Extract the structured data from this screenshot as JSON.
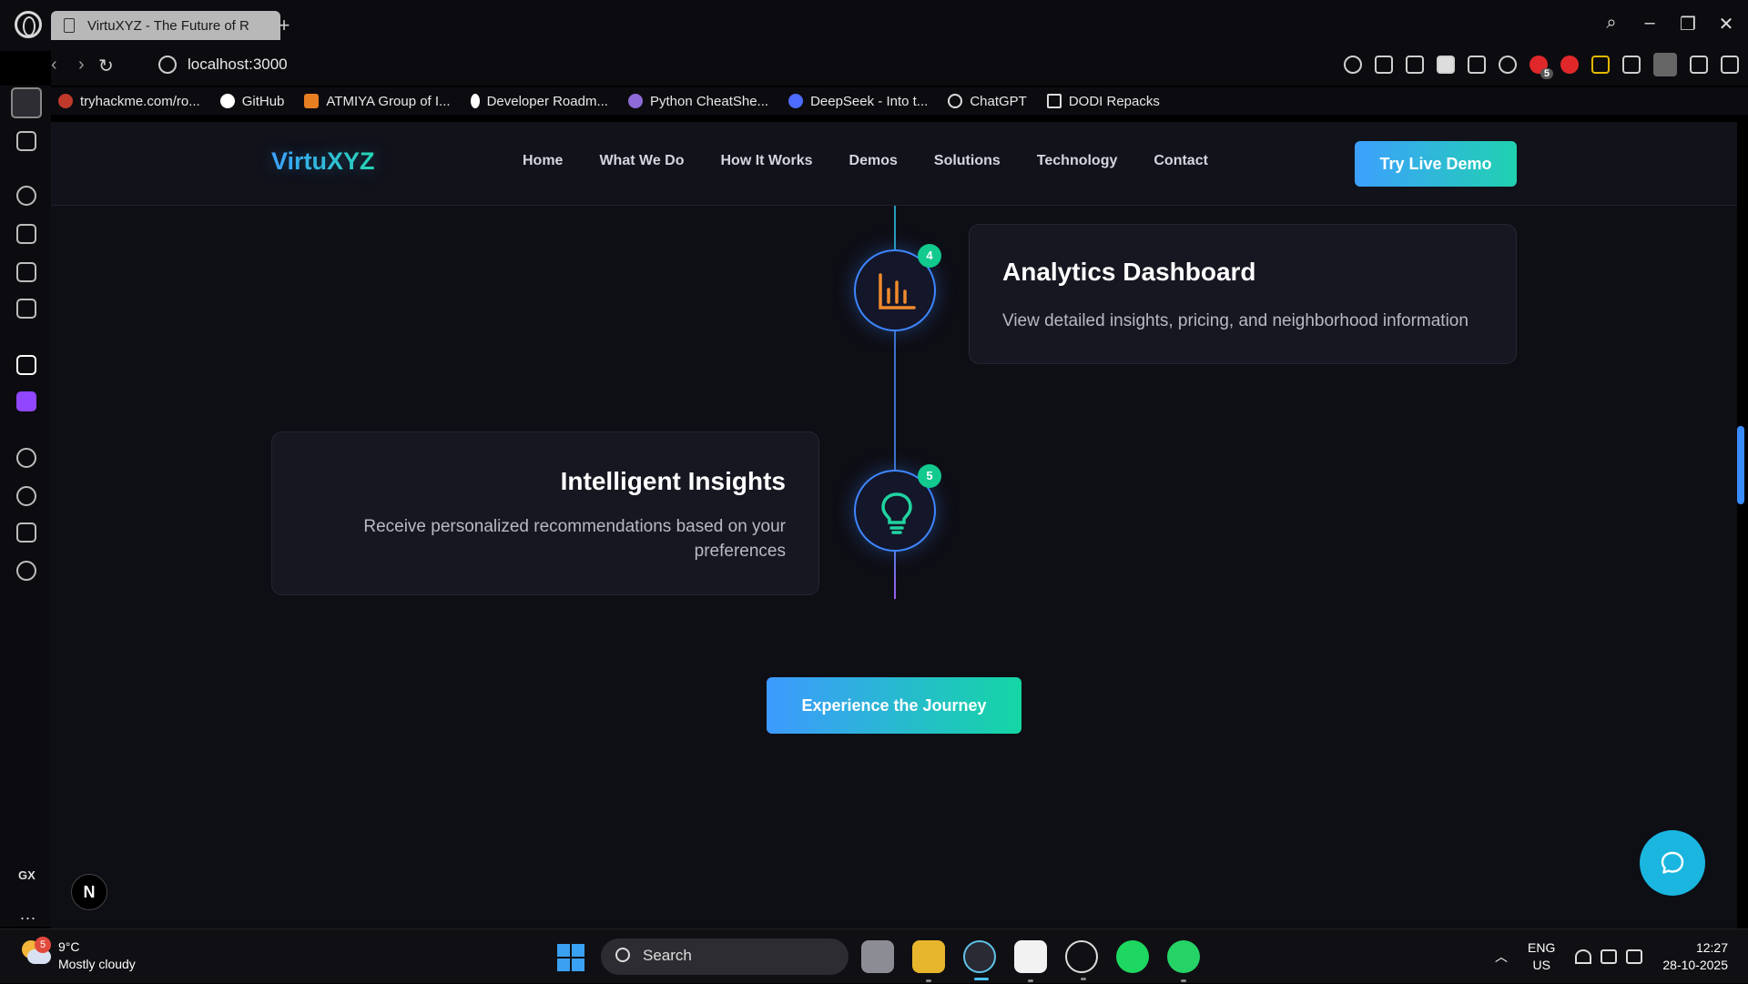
{
  "browser": {
    "tab_title": "VirtuXYZ - The Future of R",
    "new_tab_label": "+",
    "url": "localhost:3000",
    "bookmarks": [
      {
        "label": "tryhackme.com/ro...",
        "color": "#c0392b"
      },
      {
        "label": "GitHub",
        "color": "#ffffff"
      },
      {
        "label": "ATMIYA Group of I...",
        "color": "#e67e22"
      },
      {
        "label": "Developer Roadm...",
        "color": "#ffffff"
      },
      {
        "label": "Python CheatShe...",
        "color": "#8e6ad8"
      },
      {
        "label": "DeepSeek - Into t...",
        "color": "#4d6bfe"
      },
      {
        "label": "ChatGPT",
        "color": "#dddddd"
      },
      {
        "label": "DODI Repacks",
        "color": "#dddddd"
      }
    ],
    "extension_badge": "5",
    "sidebar_gx": "GX",
    "sidebar_more": "..."
  },
  "site": {
    "brand": "VirtuXYZ",
    "nav": [
      "Home",
      "What We Do",
      "How It Works",
      "Demos",
      "Solutions",
      "Technology",
      "Contact"
    ],
    "cta": "Try Live Demo",
    "steps": [
      {
        "number": "4",
        "title": "Analytics Dashboard",
        "description": "View detailed insights, pricing, and neighborhood information",
        "icon": "bar-chart-icon",
        "icon_color": "#f08a2c"
      },
      {
        "number": "5",
        "title": "Intelligent Insights",
        "description": "Receive personalized recommendations based on your preferences",
        "icon": "lightbulb-icon",
        "icon_color": "#1fd4a0"
      }
    ],
    "journey_button": "Experience the Journey",
    "dev_badge": "N"
  },
  "taskbar": {
    "temperature": "9°C",
    "condition": "Mostly cloudy",
    "weather_badge": "5",
    "search_placeholder": "Search",
    "lang_top": "ENG",
    "lang_bottom": "US",
    "time": "12:27",
    "date": "28-10-2025"
  },
  "colors": {
    "accent_blue": "#3d9aff",
    "accent_green": "#14d6a4",
    "page_bg": "#0e0e15"
  }
}
